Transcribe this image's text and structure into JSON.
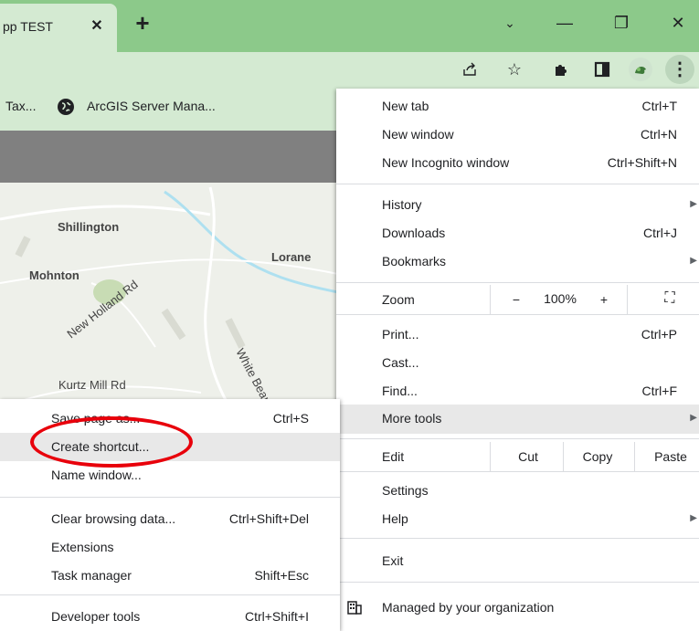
{
  "tab": {
    "title": "pp TEST",
    "close": "✕"
  },
  "new_tab": "+",
  "window": {
    "minimize": "—",
    "restore": "❐",
    "close": "✕",
    "tab_search": "⌄"
  },
  "toolbar": {
    "share_icon": "share-icon",
    "star": "☆",
    "puzzle": "✚",
    "sidepanel": "■",
    "menu": "⋮"
  },
  "bookmarks": {
    "item1": "Tax...",
    "item2": "ArcGIS Server Mana..."
  },
  "map": {
    "labels": [
      "Shillington",
      "Lorane",
      "Mohnton",
      "New Holland Rd",
      "White Bear Rd",
      "Kurtz Mill Rd"
    ]
  },
  "menu": {
    "group1": [
      {
        "label": "New tab",
        "shortcut": "Ctrl+T"
      },
      {
        "label": "New window",
        "shortcut": "Ctrl+N"
      },
      {
        "label": "New Incognito window",
        "shortcut": "Ctrl+Shift+N"
      }
    ],
    "group2": [
      {
        "label": "History",
        "shortcut": ""
      },
      {
        "label": "Downloads",
        "shortcut": "Ctrl+J"
      },
      {
        "label": "Bookmarks",
        "shortcut": ""
      }
    ],
    "zoom": {
      "label": "Zoom",
      "minus": "−",
      "value": "100%",
      "plus": "+",
      "fullscreen": "⛶"
    },
    "group3": [
      {
        "label": "Print...",
        "shortcut": "Ctrl+P"
      },
      {
        "label": "Cast...",
        "shortcut": ""
      },
      {
        "label": "Find...",
        "shortcut": "Ctrl+F"
      },
      {
        "label": "More tools",
        "shortcut": ""
      }
    ],
    "edit": {
      "label": "Edit",
      "cut": "Cut",
      "copy": "Copy",
      "paste": "Paste"
    },
    "group4": [
      {
        "label": "Settings"
      },
      {
        "label": "Help"
      }
    ],
    "exit": "Exit",
    "managed": "Managed by your organization"
  },
  "submenu": {
    "group1": [
      {
        "label": "Save page as...",
        "shortcut": "Ctrl+S"
      },
      {
        "label": "Create shortcut...",
        "shortcut": ""
      },
      {
        "label": "Name window...",
        "shortcut": ""
      }
    ],
    "group2": [
      {
        "label": "Clear browsing data...",
        "shortcut": "Ctrl+Shift+Del"
      },
      {
        "label": "Extensions",
        "shortcut": ""
      },
      {
        "label": "Task manager",
        "shortcut": "Shift+Esc"
      }
    ],
    "group3": [
      {
        "label": "Developer tools",
        "shortcut": "Ctrl+Shift+I"
      }
    ]
  },
  "colors": {
    "tabstrip": "#8cc98a",
    "toolbar": "#d4ead2",
    "highlight": "#e8e8e8",
    "annotation": "#e8000b"
  }
}
